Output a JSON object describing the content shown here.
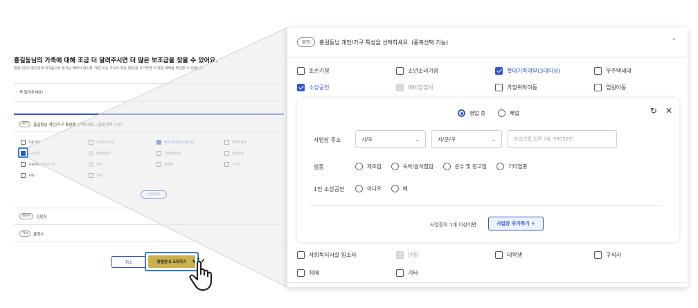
{
  "left_page": {
    "title": "홍길동님의 가족에 대해 조금 더 알려주시면 더 많은 보조금을 찾을 수 있어요.",
    "description": "행정기관의 정보연계 어려움으로 놓치는 혜택이 없도록 '개인 또는 가구의 특성 정보'를 추가하면 더 많은 혜택을 확인할 수 있습니다.",
    "note_label": "꼭 알아두세요!",
    "personal_section": {
      "tag": "본인",
      "title": "홍길동님 개인/가구 특성을 선택하세요. (중복선택 가능)"
    },
    "checkboxes": [
      {
        "label": "조손가정",
        "state": "off"
      },
      {
        "label": "소년소녀가정",
        "state": "off"
      },
      {
        "label": "확대가족여부(3대이상)",
        "state": "on"
      },
      {
        "label": "무주택세대",
        "state": "off"
      },
      {
        "label": "소상공인",
        "state": "on"
      },
      {
        "label": "예비창업자",
        "state": "disabled"
      },
      {
        "label": "가정위탁아동",
        "state": "off"
      },
      {
        "label": "임원아동",
        "state": "off"
      },
      {
        "label": "사회복지시설 입소자",
        "state": "off"
      },
      {
        "label": "난임",
        "state": "disabled"
      },
      {
        "label": "대학생",
        "state": "off"
      },
      {
        "label": "구직자",
        "state": "off"
      },
      {
        "label": "치매",
        "state": "off"
      },
      {
        "label": "기타",
        "state": "off"
      }
    ],
    "confirm_button": "선택 완료",
    "family": [
      {
        "tag": "배우자",
        "name": "김민희"
      },
      {
        "tag": "자녀",
        "name": "홍정수"
      }
    ],
    "cancel_button": "취소",
    "submit_button": "맞춤안내 조회하기"
  },
  "panel": {
    "tag": "본인",
    "title": "홍길동님 개인/가구 특성을 선택하세요. (중복선택 기능)",
    "collapse_icon": "chevron-up-icon",
    "checkboxes_top": [
      {
        "label": "조손가정",
        "state": "off"
      },
      {
        "label": "소년소녀가정",
        "state": "off"
      },
      {
        "label": "확대가족여부(3대이상)",
        "state": "on"
      },
      {
        "label": "무주택세대",
        "state": "off"
      },
      {
        "label": "소상공인",
        "state": "on"
      },
      {
        "label": "예비창업사",
        "state": "disabled"
      },
      {
        "label": "가정위탁아동",
        "state": "off"
      },
      {
        "label": "임원아동",
        "state": "off"
      }
    ],
    "detail": {
      "status_options": [
        {
          "label": "영업 중",
          "selected": true
        },
        {
          "label": "폐업",
          "selected": false
        }
      ],
      "reset_icon": "refresh-icon",
      "close_icon": "close-icon",
      "address_label": "사업장 주소",
      "sido_value": "시/도",
      "sigungu_value": "시/군/구",
      "zip_placeholder": "창업년월 입력 (예: 990529)",
      "industry_label": "업종",
      "industry_options": [
        "제조업",
        "숙박/음식점업",
        "운수 및 창고업",
        "기타업종"
      ],
      "solo_label": "1인 소상공인",
      "solo_options": [
        "아니오",
        "예"
      ],
      "add_note": "사업장이 1개 이상이면",
      "add_button": "사업장 추가하기 +"
    },
    "checkboxes_bottom": [
      {
        "label": "사회복지시설 입소자",
        "state": "off"
      },
      {
        "label": "난임",
        "state": "disabled"
      },
      {
        "label": "대학생",
        "state": "off"
      },
      {
        "label": "구직자",
        "state": "off"
      },
      {
        "label": "치매",
        "state": "off"
      },
      {
        "label": "기타",
        "state": "off"
      }
    ]
  },
  "colors": {
    "accent": "#2f55d4",
    "highlight": "#2f7bd8",
    "submit": "#c9b14b"
  }
}
